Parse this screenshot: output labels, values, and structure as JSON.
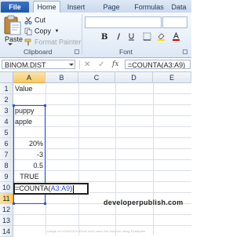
{
  "ribbon": {
    "tabs": [
      "File",
      "Home",
      "Insert",
      "Page Layout",
      "Formulas",
      "Data"
    ],
    "clipboard": {
      "paste": "Paste",
      "cut": "Cut",
      "copy": "Copy",
      "format_painter": "Format Painter",
      "group_label": "Clipboard"
    },
    "font": {
      "group_label": "Font",
      "bold": "B"
    }
  },
  "formula_bar": {
    "name_box": "BINOM.DIST",
    "cancel_icon": "✕",
    "enter_icon": "✓",
    "fx_label": "fx",
    "content": "=COUNTA(A3:A9)"
  },
  "sheet": {
    "columns": [
      "A",
      "B",
      "C",
      "D",
      "E"
    ],
    "rows": [
      "1",
      "2",
      "3",
      "4",
      "5",
      "6",
      "7",
      "8",
      "9",
      "10",
      "11",
      "12",
      "13",
      "14"
    ],
    "cells": {
      "A1": "Value",
      "A3": "puppy",
      "A4": "apple",
      "A6": "20%",
      "A7": "-3",
      "A8": "0.5",
      "A9": "TRUE"
    },
    "active_cell_edit": {
      "prefix": "=COUNTA(",
      "ref": "A3:A9",
      "suffix": ")"
    },
    "selected_column": "A",
    "selected_row": "11",
    "reference_color": "#3253c9"
  },
  "watermark": "developerpublish.com",
  "footer_note": "Usage of COUNTA in Excel and Learn the function using Examples"
}
